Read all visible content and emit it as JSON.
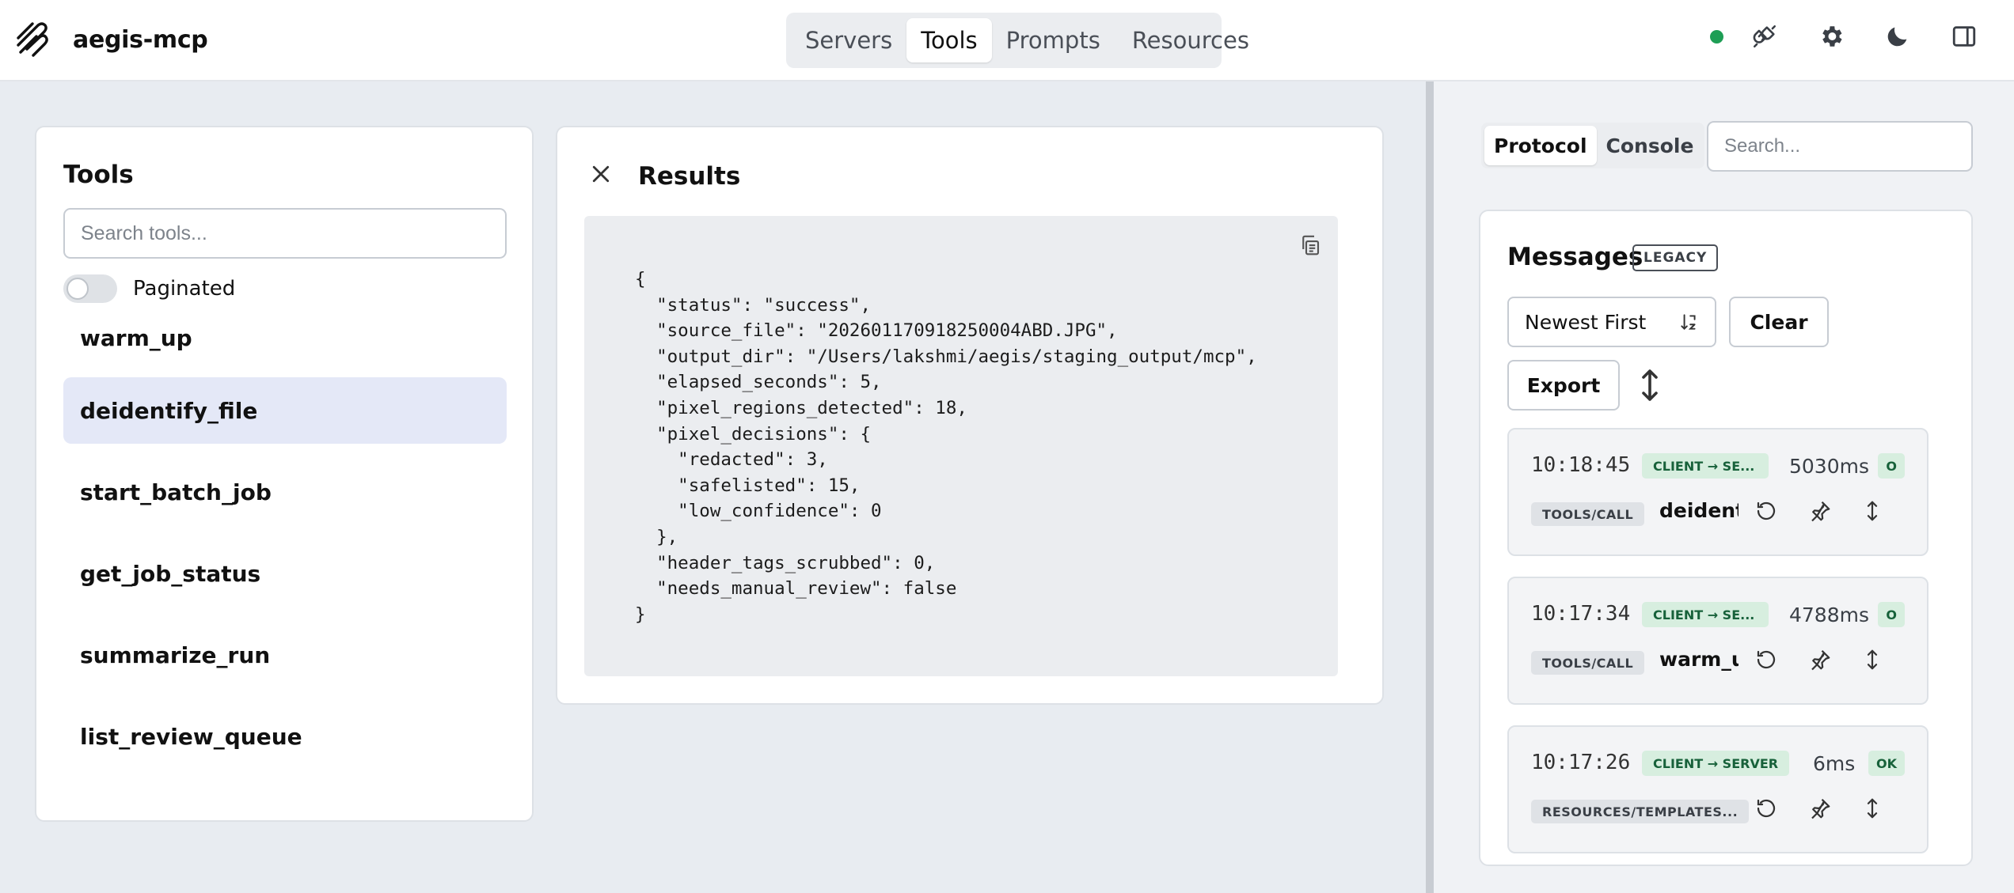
{
  "app": {
    "name": "aegis-mcp",
    "connection_status_color": "#1e9e55"
  },
  "nav": {
    "tabs": [
      "Servers",
      "Tools",
      "Prompts",
      "Resources"
    ],
    "active": "Tools"
  },
  "header_icons": [
    "plug-icon",
    "gear-icon",
    "moon-icon",
    "sidebar-toggle-icon"
  ],
  "tools_panel": {
    "title": "Tools",
    "search_placeholder": "Search tools...",
    "paginated_label": "Paginated",
    "paginated": false,
    "items": [
      "warm_up",
      "deidentify_file",
      "start_batch_job",
      "get_job_status",
      "summarize_run",
      "list_review_queue"
    ],
    "selected": "deidentify_file"
  },
  "results": {
    "title": "Results",
    "json_text": "{\n  \"status\": \"success\",\n  \"source_file\": \"202601170918250004ABD.JPG\",\n  \"output_dir\": \"/Users/lakshmi/aegis/staging_output/mcp\",\n  \"elapsed_seconds\": 5,\n  \"pixel_regions_detected\": 18,\n  \"pixel_decisions\": {\n    \"redacted\": 3,\n    \"safelisted\": 15,\n    \"low_confidence\": 0\n  },\n  \"header_tags_scrubbed\": 0,\n  \"needs_manual_review\": false\n}"
  },
  "right_panel": {
    "tabs": [
      "Protocol",
      "Console"
    ],
    "active_tab": "Protocol",
    "search_placeholder": "Search...",
    "messages": {
      "title": "Messages",
      "badge": "LEGACY",
      "sort_value": "Newest First",
      "clear_label": "Clear",
      "export_label": "Export",
      "items": [
        {
          "time": "10:18:45",
          "direction": "CLIENT → SE...",
          "duration": "5030ms",
          "status": "O",
          "method": "TOOLS/CALL",
          "name": "deidentif"
        },
        {
          "time": "10:17:34",
          "direction": "CLIENT → SE...",
          "duration": "4788ms",
          "status": "O",
          "method": "TOOLS/CALL",
          "name": "warm_up"
        },
        {
          "time": "10:17:26",
          "direction": "CLIENT → SERVER",
          "duration": "6ms",
          "status": "OK",
          "method": "RESOURCES/TEMPLATES...",
          "name": ""
        }
      ]
    }
  }
}
